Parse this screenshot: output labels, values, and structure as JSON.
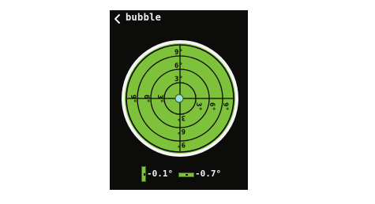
{
  "header": {
    "title": "bubble",
    "back_icon": "chevron-left-icon"
  },
  "dial": {
    "colors": {
      "background": "#7dc23a",
      "rim": "#f4f4f4",
      "lines": "#0c0c0b",
      "bubble": "#9fe2e6"
    },
    "scale_labels": {
      "top": [
        "9°",
        "6°",
        "3°"
      ],
      "bottom": [
        "3°",
        "6°",
        "9°"
      ],
      "left": [
        "9°",
        "6°",
        "3°"
      ],
      "right": [
        "3°",
        "6°",
        "9°"
      ]
    }
  },
  "readouts": {
    "vertical": {
      "value": "-0.1°",
      "bar_color": "#7dc23a"
    },
    "horizontal": {
      "value": "-0.7°",
      "bar_color": "#7dc23a"
    }
  }
}
